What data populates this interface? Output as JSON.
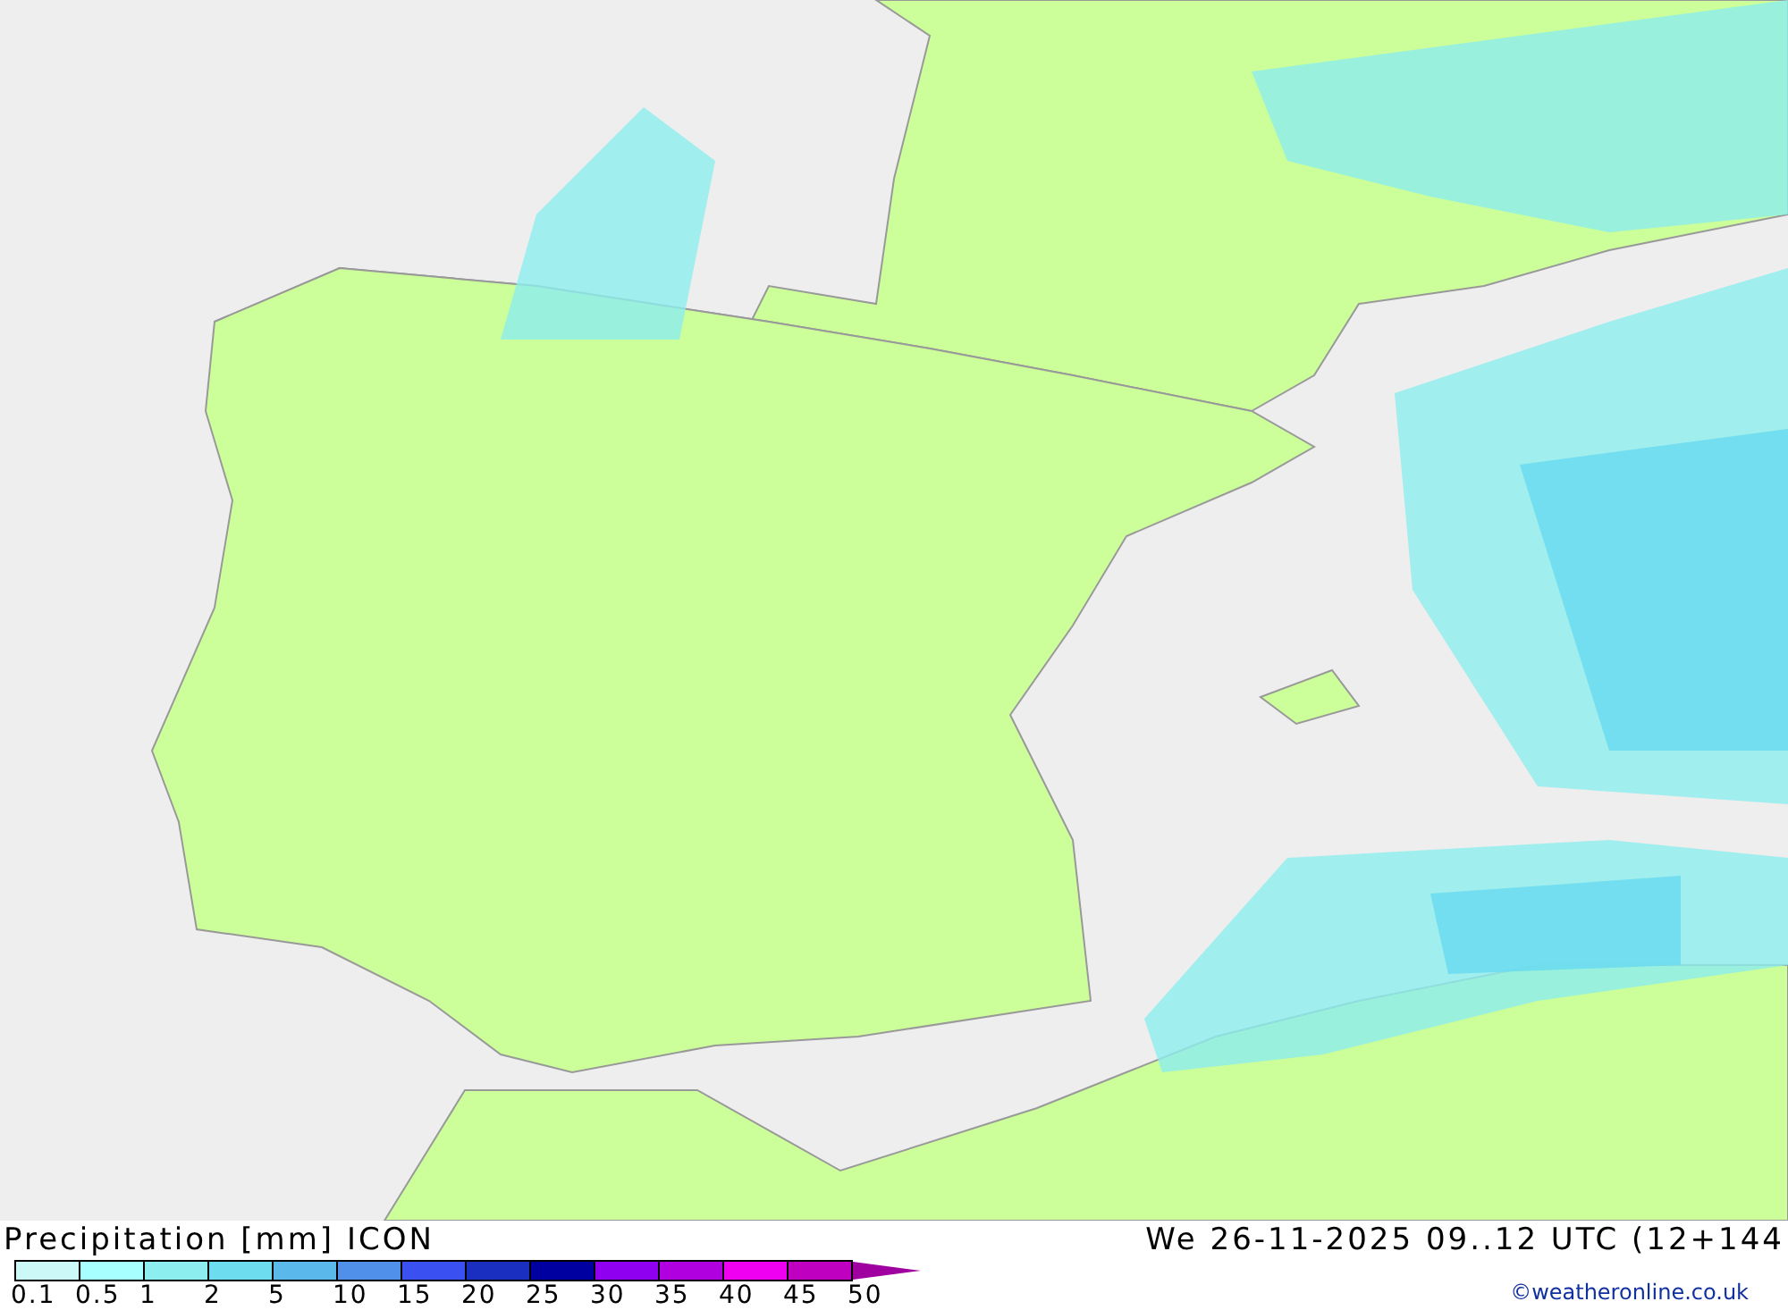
{
  "legend": {
    "title": "Precipitation [mm] ICON",
    "valid_time": "We 26-11-2025 09..12 UTC (12+144",
    "segments": [
      {
        "color": "#ccf8f8"
      },
      {
        "color": "#a8ffff"
      },
      {
        "color": "#8ceeee"
      },
      {
        "color": "#6ddcee"
      },
      {
        "color": "#5ab8ea"
      },
      {
        "color": "#5090ea"
      },
      {
        "color": "#3a50f0"
      },
      {
        "color": "#1a2ec0"
      },
      {
        "color": "#0000a0"
      },
      {
        "color": "#9000f0"
      },
      {
        "color": "#b000e0"
      },
      {
        "color": "#f000f0"
      },
      {
        "color": "#c000c0"
      }
    ],
    "ticks": [
      "0.1",
      "0.5",
      "1",
      "2",
      "5",
      "10",
      "15",
      "20",
      "25",
      "30",
      "35",
      "40",
      "45",
      "50"
    ],
    "credit": "©weatheronline.co.uk"
  }
}
